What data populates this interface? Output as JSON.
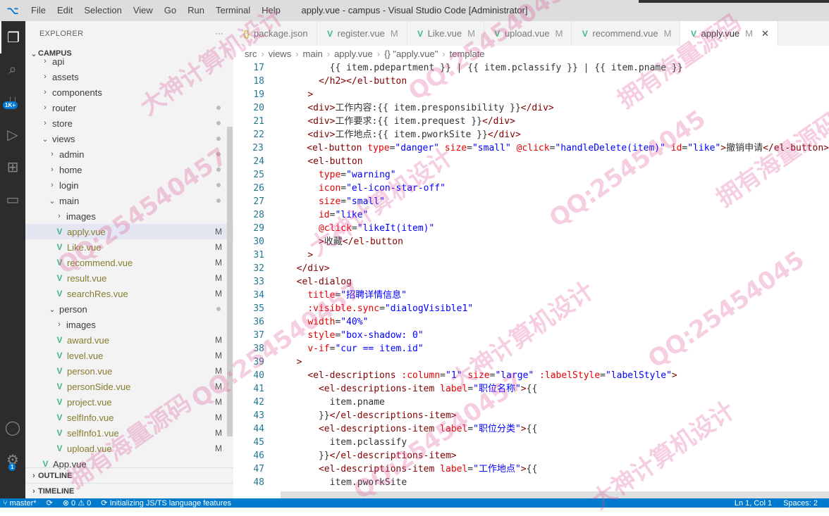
{
  "titlebar": {
    "logo": "⌥",
    "menu": [
      "File",
      "Edit",
      "Selection",
      "View",
      "Go",
      "Run",
      "Terminal",
      "Help"
    ],
    "title": "apply.vue - campus - Visual Studio Code [Administrator]"
  },
  "activity": {
    "badge": "1K+",
    "account_badge": "1"
  },
  "sidebar": {
    "header": "EXPLORER",
    "more": "···",
    "root": "CAMPUS",
    "items": [
      {
        "label": "api",
        "type": "folder",
        "depth": 1
      },
      {
        "label": "assets",
        "type": "folder",
        "depth": 1
      },
      {
        "label": "components",
        "type": "folder",
        "depth": 1
      },
      {
        "label": "router",
        "type": "folder",
        "depth": 1,
        "dot": true
      },
      {
        "label": "store",
        "type": "folder",
        "depth": 1,
        "dot": true
      },
      {
        "label": "views",
        "type": "folder-open",
        "depth": 1,
        "dot": true
      },
      {
        "label": "admin",
        "type": "folder",
        "depth": 2,
        "dot": true
      },
      {
        "label": "home",
        "type": "folder",
        "depth": 2,
        "dot": true
      },
      {
        "label": "login",
        "type": "folder",
        "depth": 2,
        "dot": true
      },
      {
        "label": "main",
        "type": "folder-open",
        "depth": 2,
        "dot": true
      },
      {
        "label": "images",
        "type": "folder",
        "depth": 3
      },
      {
        "label": "apply.vue",
        "type": "vue",
        "depth": 3,
        "mark": "M",
        "selected": true
      },
      {
        "label": "Like.vue",
        "type": "vue",
        "depth": 3,
        "mark": "M"
      },
      {
        "label": "recommend.vue",
        "type": "vue",
        "depth": 3,
        "mark": "M"
      },
      {
        "label": "result.vue",
        "type": "vue",
        "depth": 3,
        "mark": "M"
      },
      {
        "label": "searchRes.vue",
        "type": "vue",
        "depth": 3,
        "mark": "M"
      },
      {
        "label": "person",
        "type": "folder-open",
        "depth": 2,
        "dot": true
      },
      {
        "label": "images",
        "type": "folder",
        "depth": 3
      },
      {
        "label": "award.vue",
        "type": "vue",
        "depth": 3,
        "mark": "M"
      },
      {
        "label": "level.vue",
        "type": "vue",
        "depth": 3,
        "mark": "M"
      },
      {
        "label": "person.vue",
        "type": "vue",
        "depth": 3,
        "mark": "M"
      },
      {
        "label": "personSide.vue",
        "type": "vue",
        "depth": 3,
        "mark": "M"
      },
      {
        "label": "project.vue",
        "type": "vue",
        "depth": 3,
        "mark": "M"
      },
      {
        "label": "selfInfo.vue",
        "type": "vue",
        "depth": 3,
        "mark": "M"
      },
      {
        "label": "selfInfo1.vue",
        "type": "vue",
        "depth": 3,
        "mark": "M"
      },
      {
        "label": "upload.vue",
        "type": "vue",
        "depth": 3,
        "mark": "M"
      },
      {
        "label": "App.vue",
        "type": "vue",
        "depth": 1
      }
    ],
    "outline": "OUTLINE",
    "timeline": "TIMELINE"
  },
  "tabs": [
    {
      "label": "package.json",
      "icon": "{}",
      "mark": ""
    },
    {
      "label": "register.vue",
      "icon": "V",
      "mark": "M"
    },
    {
      "label": "Like.vue",
      "icon": "V",
      "mark": "M"
    },
    {
      "label": "upload.vue",
      "icon": "V",
      "mark": "M"
    },
    {
      "label": "recommend.vue",
      "icon": "V",
      "mark": "M"
    },
    {
      "label": "apply.vue",
      "icon": "V",
      "mark": "M",
      "active": true
    }
  ],
  "breadcrumbs": [
    "src",
    "views",
    "main",
    "apply.vue",
    "{} \"apply.vue\"",
    "template"
  ],
  "code_lines": [
    {
      "n": "17",
      "indent": 4,
      "html": "<span class='p'>{{ item.pdepartment }} | {{ item.pclassify }} | {{ item.pname }}</span>"
    },
    {
      "n": "18",
      "indent": 3,
      "html": "<span class='t'>&lt;/h2&gt;&lt;/el-button</span>"
    },
    {
      "n": "19",
      "indent": 2,
      "html": "<span class='t'>&gt;</span>"
    },
    {
      "n": "20",
      "indent": 2,
      "html": "<span class='t'>&lt;div&gt;</span>工作内容:{{ item.presponsibility }}<span class='t'>&lt;/div&gt;</span>"
    },
    {
      "n": "21",
      "indent": 2,
      "html": "<span class='t'>&lt;div&gt;</span>工作要求:{{ item.prequest }}<span class='t'>&lt;/div&gt;</span>"
    },
    {
      "n": "22",
      "indent": 2,
      "html": "<span class='t'>&lt;div&gt;</span>工作地点:{{ item.pworkSite }}<span class='t'>&lt;/div&gt;</span>"
    },
    {
      "n": "23",
      "indent": 2,
      "html": "<span class='t'>&lt;el-button</span> <span class='a'>type</span>=<span class='s'>\"danger\"</span> <span class='a'>size</span>=<span class='s'>\"small\"</span> <span class='a'>@click</span>=<span class='s'>\"handleDelete(item)\"</span> <span class='a'>id</span>=<span class='s'>\"like\"</span><span class='t'>&gt;</span>撤销申请<span class='t'>&lt;/el-button&gt;</span>"
    },
    {
      "n": "24",
      "indent": 2,
      "html": "<span class='t'>&lt;el-button</span>"
    },
    {
      "n": "25",
      "indent": 3,
      "html": "<span class='a'>type</span>=<span class='s'>\"warning\"</span>"
    },
    {
      "n": "26",
      "indent": 3,
      "html": "<span class='a'>icon</span>=<span class='s'>\"el-icon-star-off\"</span>"
    },
    {
      "n": "27",
      "indent": 3,
      "html": "<span class='a'>size</span>=<span class='s'>\"small\"</span>"
    },
    {
      "n": "28",
      "indent": 3,
      "html": "<span class='a'>id</span>=<span class='s'>\"like\"</span>"
    },
    {
      "n": "29",
      "indent": 3,
      "html": "<span class='a'>@click</span>=<span class='s'>\"likeIt(item)\"</span>"
    },
    {
      "n": "30",
      "indent": 3,
      "html": "<span class='t'>&gt;</span>收藏<span class='t'>&lt;/el-button</span>"
    },
    {
      "n": "31",
      "indent": 2,
      "html": "<span class='t'>&gt;</span>"
    },
    {
      "n": "32",
      "indent": 1,
      "html": "<span class='t'>&lt;/div&gt;</span>"
    },
    {
      "n": "33",
      "indent": 1,
      "html": "<span class='t'>&lt;el-dialog</span>"
    },
    {
      "n": "34",
      "indent": 2,
      "html": "<span class='a'>title</span>=<span class='s'>\"招聘详情信息\"</span>"
    },
    {
      "n": "35",
      "indent": 2,
      "html": "<span class='a'>:visible.sync</span>=<span class='s'>\"dialogVisible1\"</span>"
    },
    {
      "n": "36",
      "indent": 2,
      "html": "<span class='a'>width</span>=<span class='s'>\"40%\"</span>"
    },
    {
      "n": "37",
      "indent": 2,
      "html": "<span class='a'>style</span>=<span class='s'>\"box-shadow: 0\"</span>"
    },
    {
      "n": "38",
      "indent": 2,
      "html": "<span class='a'>v-if</span>=<span class='s'>\"cur == item.id\"</span>"
    },
    {
      "n": "39",
      "indent": 1,
      "html": "<span class='t'>&gt;</span>"
    },
    {
      "n": "40",
      "indent": 2,
      "html": "<span class='t'>&lt;el-descriptions</span> <span class='a'>:column</span>=<span class='s'>\"1\"</span> <span class='a'>size</span>=<span class='s'>\"large\"</span> <span class='a'>:labelStyle</span>=<span class='s'>\"labelStyle\"</span><span class='t'>&gt;</span>"
    },
    {
      "n": "41",
      "indent": 3,
      "html": "<span class='t'>&lt;el-descriptions-item</span> <span class='a'>label</span>=<span class='s'>\"职位名称\"</span><span class='t'>&gt;</span>{{"
    },
    {
      "n": "42",
      "indent": 4,
      "html": "item.pname"
    },
    {
      "n": "43",
      "indent": 3,
      "html": "}}<span class='t'>&lt;/el-descriptions-item&gt;</span>"
    },
    {
      "n": "44",
      "indent": 3,
      "html": "<span class='t'>&lt;el-descriptions-item</span> <span class='a'>label</span>=<span class='s'>\"职位分类\"</span><span class='t'>&gt;</span>{{"
    },
    {
      "n": "45",
      "indent": 4,
      "html": "item.pclassify"
    },
    {
      "n": "46",
      "indent": 3,
      "html": "}}<span class='t'>&lt;/el-descriptions-item&gt;</span>"
    },
    {
      "n": "47",
      "indent": 3,
      "html": "<span class='t'>&lt;el-descriptions-item</span> <span class='a'>label</span>=<span class='s'>\"工作地点\"</span><span class='t'>&gt;</span>{{"
    },
    {
      "n": "48",
      "indent": 4,
      "html": "item.pworkSite"
    }
  ],
  "status": {
    "branch": "master*",
    "sync": "⟳",
    "errors": "⊗ 0",
    "warnings": "⚠ 0",
    "task": "Initializing JS/TS language features",
    "position": "Ln 1, Col 1",
    "spaces": "Spaces: 2"
  },
  "watermarks": [
    "大神计算机设计",
    "QQ:25454045",
    "拥有海量源码",
    "QQ:2545404​57"
  ]
}
